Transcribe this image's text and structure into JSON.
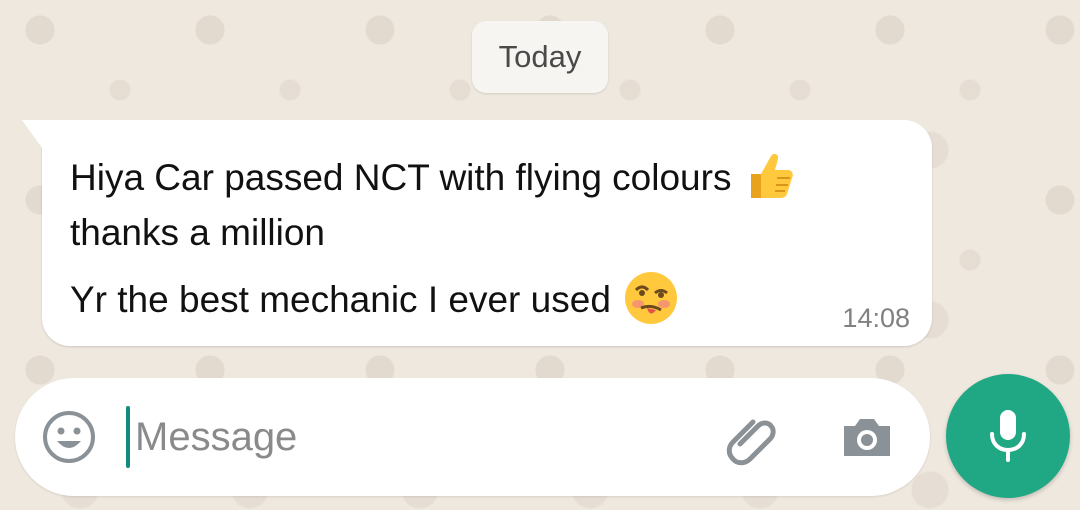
{
  "chat": {
    "date_label": "Today",
    "message": {
      "line1": "Hiya Car passed NCT with flying colours",
      "line1_emoji": "thumbs-up-icon",
      "line2": "thanks a million",
      "line3": "Yr the best mechanic I ever used",
      "line3_emoji": "woozy-face-icon",
      "time": "14:08"
    }
  },
  "composer": {
    "placeholder": "Message",
    "value": "",
    "icons": {
      "emoji": "smiley-icon",
      "attach": "paperclip-icon",
      "camera": "camera-icon",
      "voice": "microphone-icon"
    }
  },
  "colors": {
    "accent": "#20a884",
    "bubble": "#ffffff",
    "wallpaper": "#efe8df"
  }
}
